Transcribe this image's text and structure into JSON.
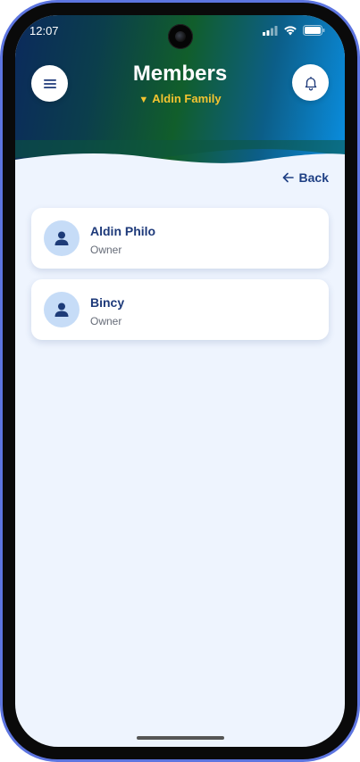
{
  "status_bar": {
    "time": "12:07",
    "icons": [
      "signal-icon",
      "wifi-icon",
      "battery-icon"
    ]
  },
  "header": {
    "title": "Members",
    "family_selector": "Aldin Family",
    "menu_icon": "hamburger-menu-icon",
    "notification_icon": "bell-icon"
  },
  "navigation": {
    "back_label": "Back",
    "back_icon": "arrow-left-icon"
  },
  "members": [
    {
      "name": "Aldin Philo",
      "role": "Owner",
      "icon": "user-icon"
    },
    {
      "name": "Bincy",
      "role": "Owner",
      "icon": "user-icon"
    }
  ],
  "colors": {
    "accent_text": "#1e3a7a",
    "selector_text": "#f4c430",
    "avatar_bg": "#c6dcf7",
    "screen_bg": "#eef4fe"
  }
}
